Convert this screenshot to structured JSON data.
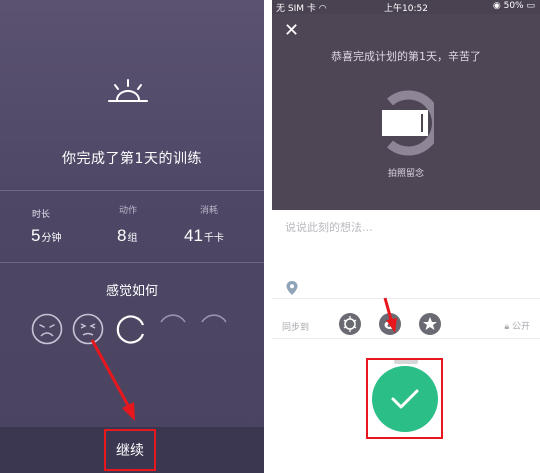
{
  "left": {
    "done_text": "你完成了第1天的训练",
    "stats": [
      {
        "label": "时长",
        "value": "5",
        "unit": "分钟"
      },
      {
        "label": "动作",
        "value": "8",
        "unit": "组"
      },
      {
        "label": "消耗",
        "value": "41",
        "unit": "千卡"
      }
    ],
    "feeling_title": "感觉如何",
    "faces": [
      "very-bad-face-icon",
      "bad-face-icon",
      "ok-face-icon",
      "good-face-icon",
      "great-face-icon"
    ],
    "continue_label": "继续"
  },
  "right": {
    "status_bar": {
      "carrier": "无 SIM 卡 ",
      "time": "上午10:52",
      "battery": "50%"
    },
    "congrats": "恭喜完成计划的第1天，辛苦了",
    "photo_caption": "拍照留念",
    "thoughts_placeholder": "说说此刻的想法...",
    "sync_label": "同步到",
    "public_label": "公开"
  },
  "colors": {
    "left_bg": "#4d4765",
    "photo_bg": "#4f4655",
    "confirm_green": "#2bbe86",
    "highlight_red": "#e8171d"
  }
}
